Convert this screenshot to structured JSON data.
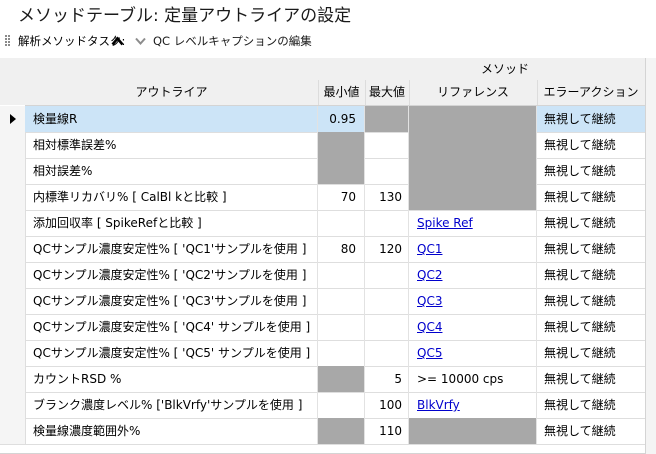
{
  "title": "メソッドテーブル: 定量アウトライアの設定",
  "toolbar": {
    "analysis_task_label": "解析メソッドタスク:",
    "qc_caption_label": "QC レベルキャプションの編集"
  },
  "columns": {
    "group_method": "メソッド",
    "outlier": "アウトライア",
    "min": "最小値",
    "max": "最大値",
    "reference": "リファレンス",
    "error_action": "エラーアクション"
  },
  "rows": [
    {
      "outlier": "検量線R",
      "min": "0.95",
      "max": "",
      "ref": "",
      "ref_link": false,
      "err": "無視して継続",
      "gray": [
        "max",
        "ref"
      ],
      "selected": true
    },
    {
      "outlier": "相対標準誤差%",
      "min": "",
      "max": "",
      "ref": "",
      "ref_link": false,
      "err": "無視して継続",
      "gray": [
        "min",
        "ref"
      ],
      "selected": false
    },
    {
      "outlier": "相対誤差%",
      "min": "",
      "max": "",
      "ref": "",
      "ref_link": false,
      "err": "無視して継続",
      "gray": [
        "min",
        "ref"
      ],
      "selected": false
    },
    {
      "outlier": "内標準リカバリ%  [ CalBl kと比較 ]",
      "min": "70",
      "max": "130",
      "ref": "",
      "ref_link": false,
      "err": "無視して継続",
      "gray": [
        "ref"
      ],
      "selected": false
    },
    {
      "outlier": "添加回収率  [ SpikeRefと比較 ]",
      "min": "",
      "max": "",
      "ref": "Spike Ref",
      "ref_link": true,
      "err": "無視して継続",
      "gray": [],
      "selected": false
    },
    {
      "outlier": "QCサンプル濃度安定性%  [ 'QC1'サンプルを使用 ]",
      "min": "80",
      "max": "120",
      "ref": "QC1",
      "ref_link": true,
      "err": "無視して継続",
      "gray": [],
      "selected": false
    },
    {
      "outlier": "QCサンプル濃度安定性%  [ 'QC2'サンプルを使用 ]",
      "min": "",
      "max": "",
      "ref": "QC2",
      "ref_link": true,
      "err": "無視して継続",
      "gray": [],
      "selected": false
    },
    {
      "outlier": "QCサンプル濃度安定性%  [ 'QC3'サンプルを使用 ]",
      "min": "",
      "max": "",
      "ref": "QC3",
      "ref_link": true,
      "err": "無視して継続",
      "gray": [],
      "selected": false
    },
    {
      "outlier": "QCサンプル濃度安定性%  [ 'QC4' サンプルを使用 ]",
      "min": "",
      "max": "",
      "ref": "QC4",
      "ref_link": true,
      "err": "無視して継続",
      "gray": [],
      "selected": false
    },
    {
      "outlier": "QCサンプル濃度安定性%  [ 'QC5' サンプルを使用 ]",
      "min": "",
      "max": "",
      "ref": "QC5",
      "ref_link": true,
      "err": "無視して継続",
      "gray": [],
      "selected": false
    },
    {
      "outlier": "カウントRSD %",
      "min": "",
      "max": "5",
      "ref": " >= 10000 cps",
      "ref_link": false,
      "err": "無視して継続",
      "gray": [
        "min"
      ],
      "selected": false
    },
    {
      "outlier": "ブランク濃度レベル% ['BlkVrfy'サンプルを使用 ]",
      "min": "",
      "max": "100",
      "ref": "BlkVrfy",
      "ref_link": true,
      "err": "無視して継続",
      "gray": [],
      "selected": false
    },
    {
      "outlier": "検量線濃度範囲外%",
      "min": "",
      "max": "110",
      "ref": "",
      "ref_link": false,
      "err": "無視して継続",
      "gray": [
        "min",
        "ref"
      ],
      "selected": false
    }
  ]
}
